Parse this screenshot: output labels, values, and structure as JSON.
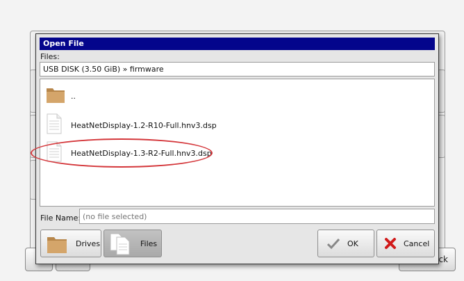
{
  "background": {
    "nav_back_label": "ck"
  },
  "dialog": {
    "title": "Open File",
    "files_label": "Files:",
    "path": "USB DISK (3.50 GiB) » firmware",
    "entries": [
      {
        "label": "..",
        "icon": "folder-icon"
      },
      {
        "label": "HeatNetDisplay-1.2-R10-Full.hnv3.dsp",
        "icon": "document-icon"
      },
      {
        "label": "HeatNetDisplay-1.3-R2-Full.hnv3.dsp",
        "icon": "document-icon"
      }
    ],
    "filename_label": "File Name:",
    "filename_placeholder": "(no file selected)",
    "buttons": {
      "drives": "Drives",
      "files": "Files",
      "ok": "OK",
      "cancel": "Cancel"
    }
  },
  "colors": {
    "titlebar": "#04058c",
    "highlight": "#d4363a",
    "cancel_x": "#d11a1a",
    "folder": "#c89a5c"
  }
}
